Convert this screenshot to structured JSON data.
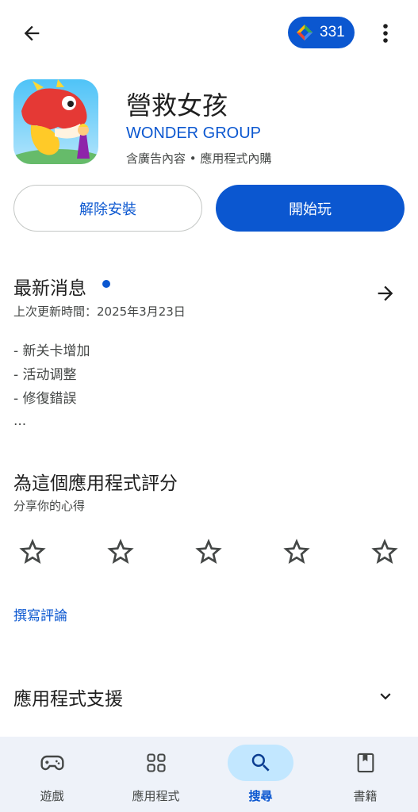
{
  "topbar": {
    "points": "331",
    "back_icon": "arrow-left-icon",
    "more_icon": "more-vert-icon",
    "points_icon": "play-points-diamond-icon"
  },
  "app": {
    "title": "營救女孩",
    "developer": "WONDER GROUP",
    "meta": "含廣告內容 • 應用程式內購"
  },
  "actions": {
    "uninstall_label": "解除安裝",
    "play_label": "開始玩"
  },
  "whats_new": {
    "title": "最新消息",
    "updated": "上次更新時間：2025年3月23日",
    "notes": [
      "- 新关卡增加",
      "- 活动调整",
      "- 修復錯誤"
    ],
    "ellipsis": "..."
  },
  "rating": {
    "title": "為這個應用程式評分",
    "subtitle": "分享你的心得",
    "stars_selected": 0,
    "stars_total": 5,
    "write_review": "撰寫評論"
  },
  "support": {
    "title": "應用程式支援"
  },
  "bottom_nav": {
    "items": [
      {
        "label": "遊戲",
        "icon": "gamepad-icon",
        "active": false
      },
      {
        "label": "應用程式",
        "icon": "apps-grid-icon",
        "active": false
      },
      {
        "label": "搜尋",
        "icon": "search-icon",
        "active": true
      },
      {
        "label": "書籍",
        "icon": "bookmark-icon",
        "active": false
      }
    ]
  },
  "colors": {
    "accent": "#0b57d0",
    "nav_background": "#eef2f9",
    "active_pill": "#c2e7ff"
  }
}
